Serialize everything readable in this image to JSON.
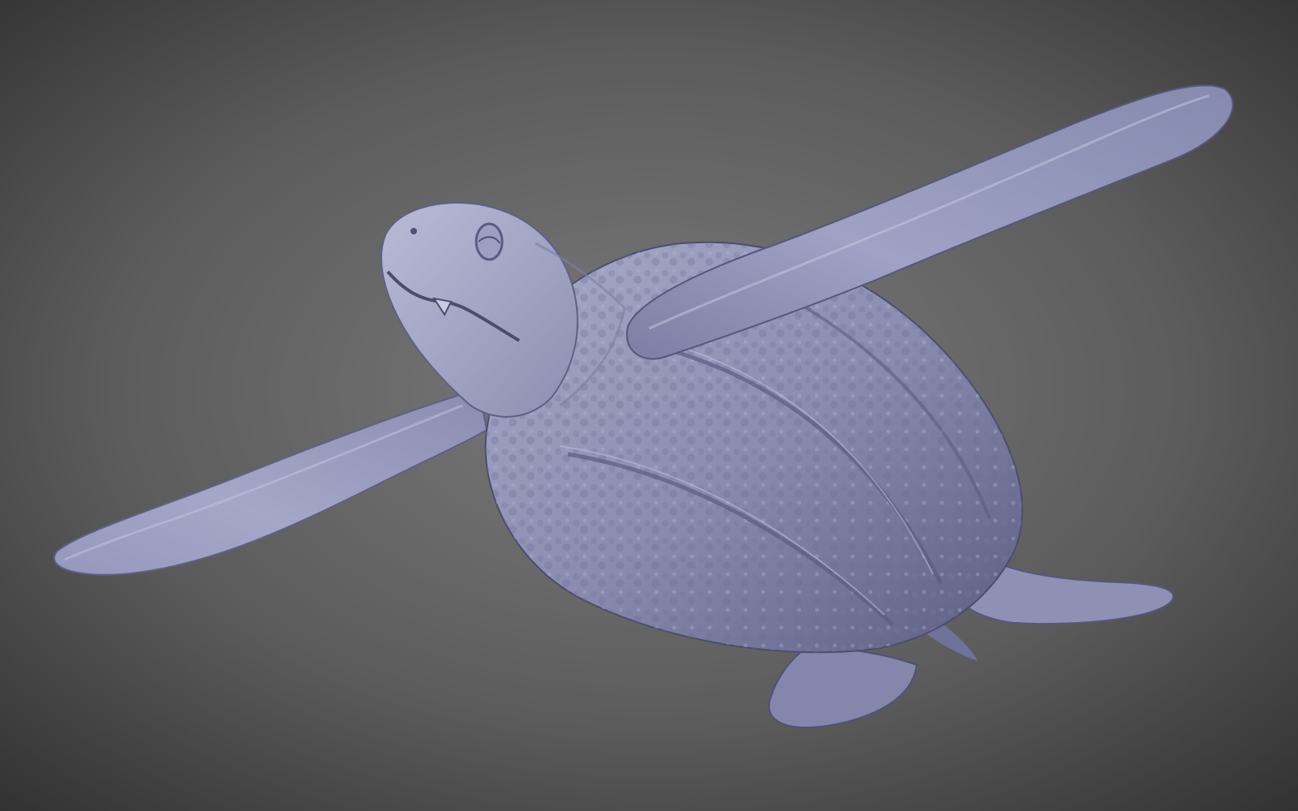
{
  "scene": {
    "subject": "sea-turtle-sculpt",
    "colors": {
      "background_center": "#7a7a7a",
      "background_edge": "#2e2e2e",
      "model_light": "#b9bbd6",
      "model_mid": "#8a8db0",
      "model_dark": "#4a4d6e"
    }
  }
}
